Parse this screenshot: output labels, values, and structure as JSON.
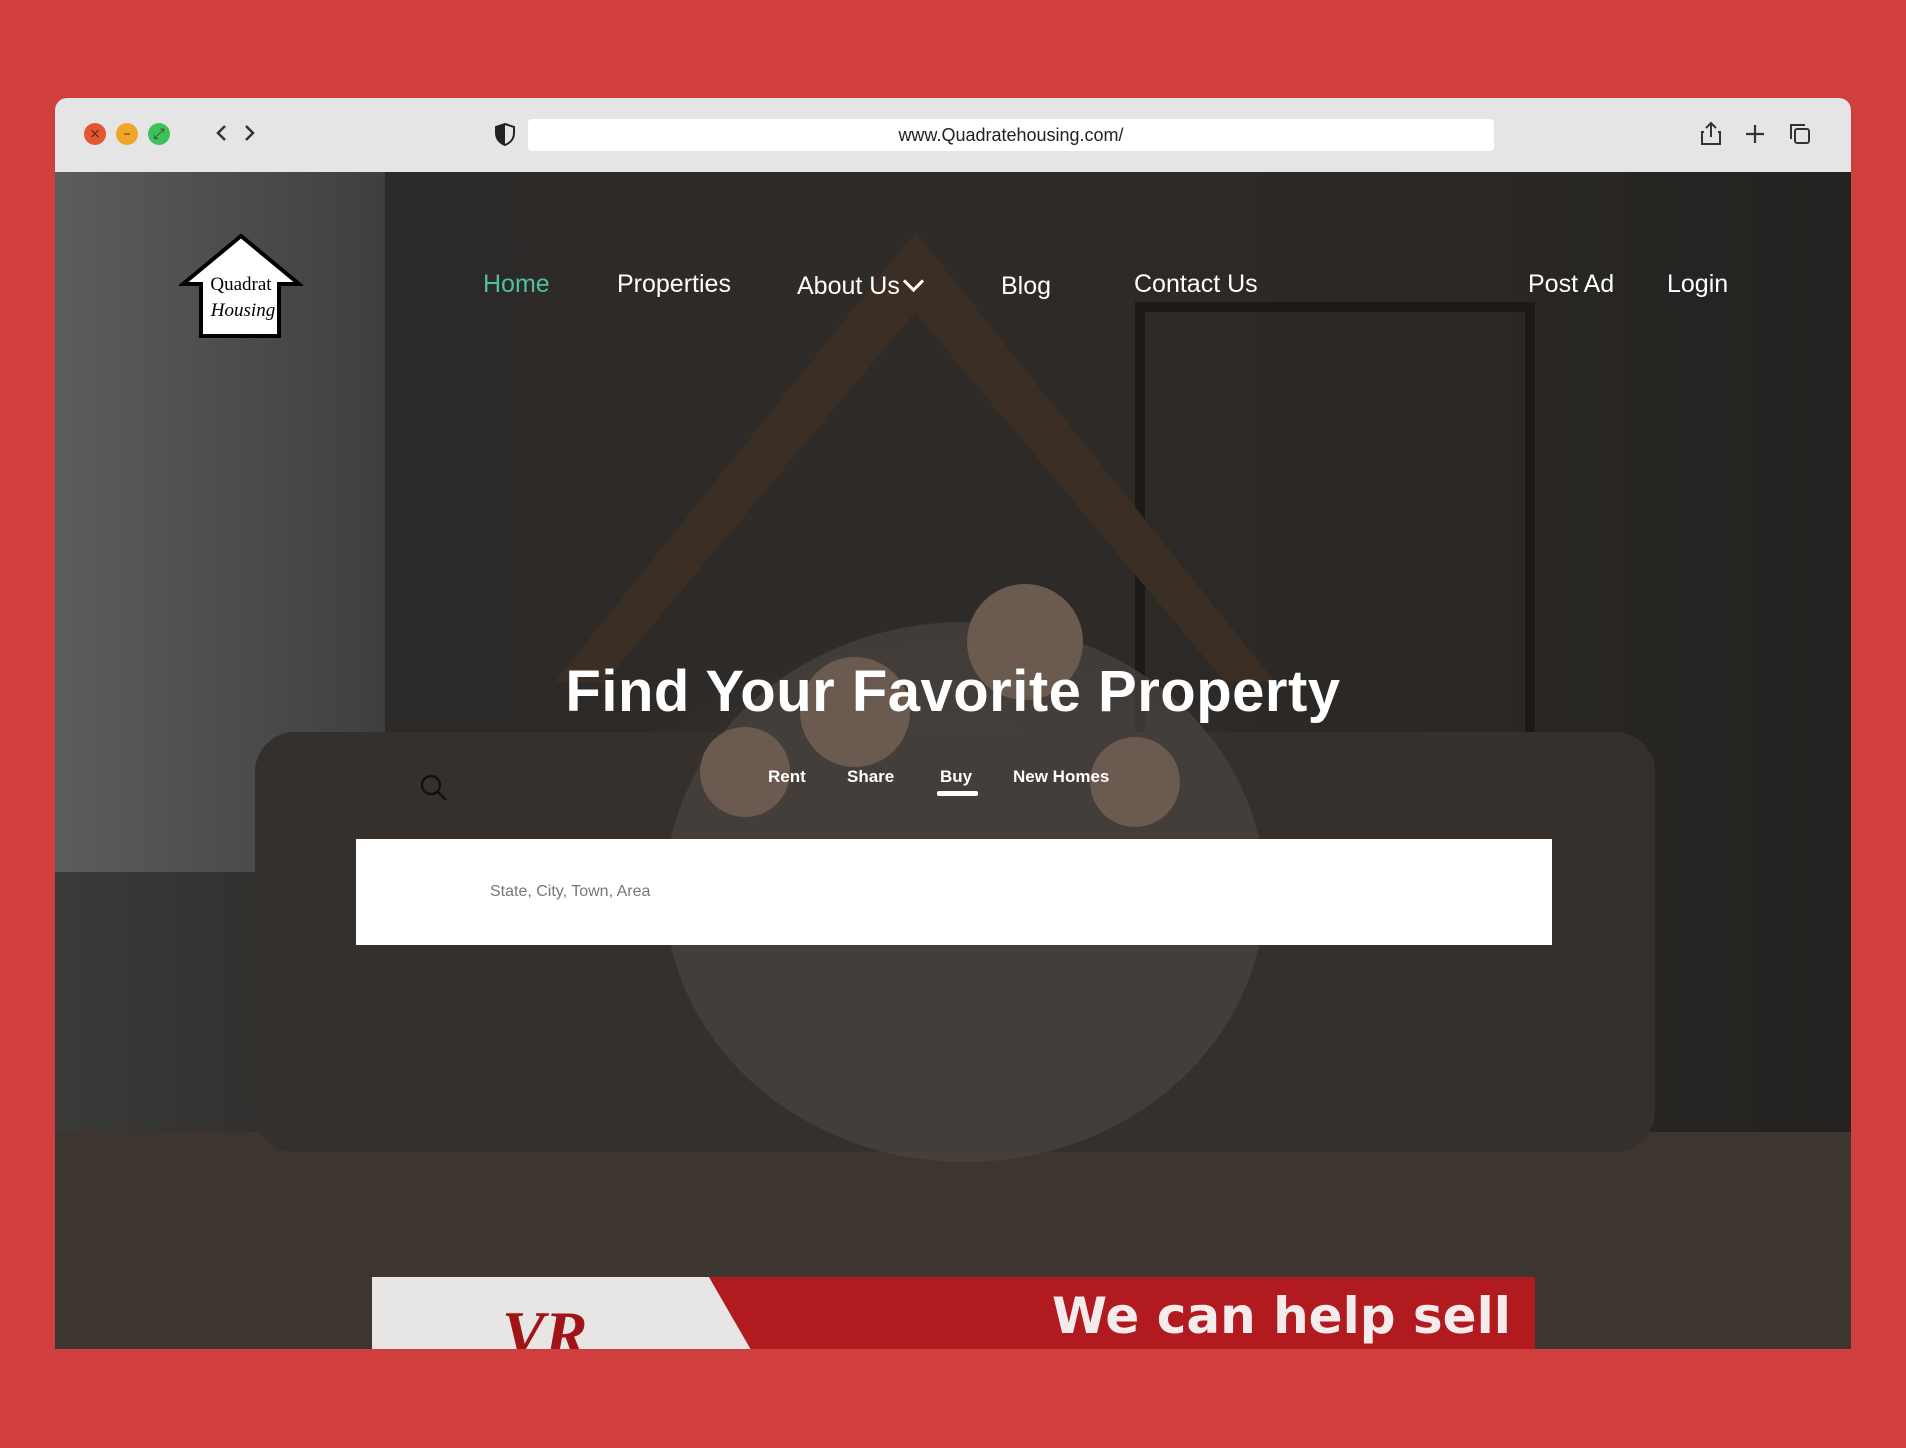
{
  "browser": {
    "url": "www.Quadratehousing.com/",
    "back_icon": "chevron-left-icon",
    "forward_icon": "chevron-right-icon",
    "shield_icon": "shield-icon",
    "share_icon": "share-icon",
    "new_tab_icon": "plus-icon",
    "tabs_icon": "tabs-icon"
  },
  "logo": {
    "line1": "Quadrat",
    "line2": "Housing"
  },
  "nav": {
    "home": "Home",
    "properties": "Properties",
    "about": "About Us",
    "blog": "Blog",
    "contact": "Contact Us",
    "post_ad": "Post Ad",
    "login": "Login",
    "active_color": "#4fbfa0"
  },
  "hero": {
    "headline": "Find Your Favorite Property",
    "tabs": [
      "Rent",
      "Share",
      "Buy",
      "New Homes"
    ],
    "selected_tab": "Buy",
    "search_placeholder": "State, City, Town, Area"
  },
  "ad": {
    "text": "We can help sell",
    "logo_text": "VR"
  },
  "colors": {
    "frame": "#d13e3e",
    "accent": "#4fbfa0",
    "ad_red": "#b11a1e"
  }
}
